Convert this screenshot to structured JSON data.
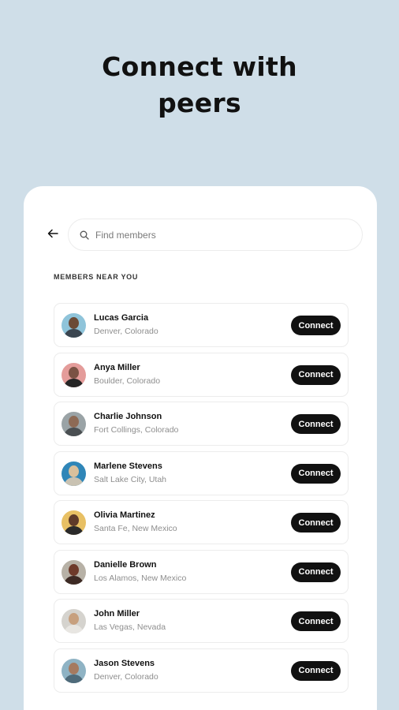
{
  "headline": "Connect with peers",
  "search": {
    "placeholder": "Find members"
  },
  "section_title": "MEMBERS NEAR YOU",
  "connect_label": "Connect",
  "members": [
    {
      "name": "Lucas Garcia",
      "location": "Denver, Colorado",
      "avatar_bg": "#8fc4da",
      "skin": "#6b4a36",
      "shirt": "#3b4650"
    },
    {
      "name": "Anya Miller",
      "location": "Boulder, Colorado",
      "avatar_bg": "#e49c9a",
      "skin": "#7a5244",
      "shirt": "#262626"
    },
    {
      "name": "Charlie Johnson",
      "location": "Fort Collings, Colorado",
      "avatar_bg": "#9aa3a6",
      "skin": "#8d6a55",
      "shirt": "#4a4f52"
    },
    {
      "name": "Marlene Stevens",
      "location": "Salt Lake City, Utah",
      "avatar_bg": "#2f86b8",
      "skin": "#d9c09c",
      "shirt": "#c9c2b2"
    },
    {
      "name": "Olivia Martinez",
      "location": "Santa Fe, New Mexico",
      "avatar_bg": "#e8c064",
      "skin": "#5e3a29",
      "shirt": "#2a2a2a"
    },
    {
      "name": "Danielle Brown",
      "location": "Los Alamos, New Mexico",
      "avatar_bg": "#b7b1a6",
      "skin": "#6e3a2a",
      "shirt": "#3d2a24"
    },
    {
      "name": "John Miller",
      "location": "Las Vegas, Nevada",
      "avatar_bg": "#d5d3ce",
      "skin": "#c7a07e",
      "shirt": "#e8e6e2"
    },
    {
      "name": "Jason Stevens",
      "location": "Denver, Colorado",
      "avatar_bg": "#8fb3c4",
      "skin": "#a57a60",
      "shirt": "#4f6b7a"
    }
  ]
}
